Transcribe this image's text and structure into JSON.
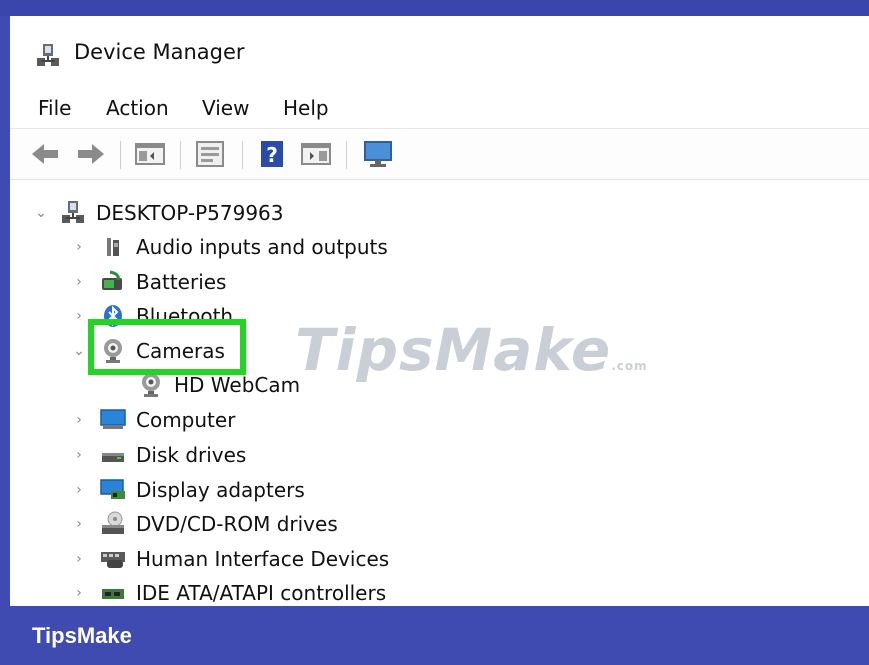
{
  "window": {
    "title": "Device Manager"
  },
  "menu": {
    "items": [
      "File",
      "Action",
      "View",
      "Help"
    ]
  },
  "tree": {
    "root": "DESKTOP-P579963",
    "items": [
      {
        "label": "Audio inputs and outputs",
        "icon": "speaker-icon",
        "expanded": false
      },
      {
        "label": "Batteries",
        "icon": "battery-icon",
        "expanded": false
      },
      {
        "label": "Bluetooth",
        "icon": "bluetooth-icon",
        "expanded": false
      },
      {
        "label": "Cameras",
        "icon": "webcam-icon",
        "expanded": true,
        "selected_highlight": true
      },
      {
        "label": "HD WebCam",
        "icon": "webcam-icon",
        "child": true
      },
      {
        "label": "Computer",
        "icon": "monitor-icon",
        "expanded": false
      },
      {
        "label": "Disk drives",
        "icon": "disk-drive-icon",
        "expanded": false
      },
      {
        "label": "Display adapters",
        "icon": "display-adapter-icon",
        "expanded": false
      },
      {
        "label": "DVD/CD-ROM drives",
        "icon": "dvd-drive-icon",
        "expanded": false
      },
      {
        "label": "Human Interface Devices",
        "icon": "hid-icon",
        "expanded": false
      },
      {
        "label": "IDE ATA/ATAPI controllers",
        "icon": "ide-controller-icon",
        "expanded": false
      }
    ]
  },
  "watermark": {
    "text": "TipsMake",
    "suffix": ".com"
  },
  "footer": {
    "brand": "TipsMake"
  },
  "colors": {
    "highlight": "#22d522",
    "band": "#3f4bb1"
  }
}
